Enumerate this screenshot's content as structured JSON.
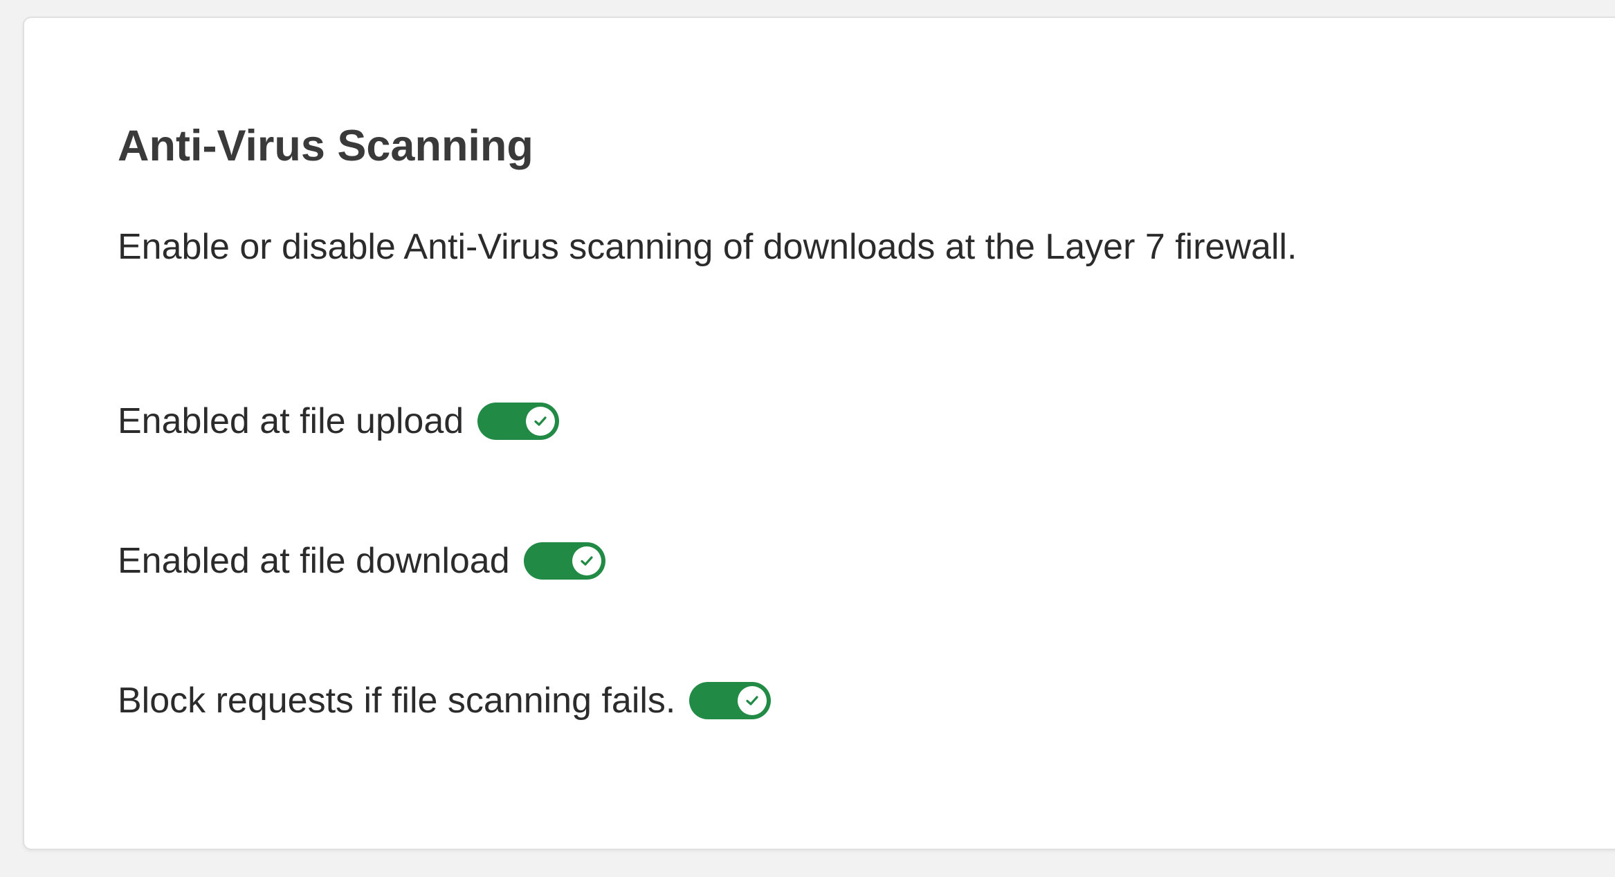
{
  "section": {
    "title": "Anti-Virus Scanning",
    "description": "Enable or disable Anti-Virus scanning of downloads at the Layer 7 firewall."
  },
  "settings": [
    {
      "label": "Enabled at file upload",
      "enabled": true,
      "icon": "check-icon"
    },
    {
      "label": "Enabled at file download",
      "enabled": true,
      "icon": "check-icon"
    },
    {
      "label": "Block requests if file scanning fails.",
      "enabled": true,
      "icon": "check-icon"
    }
  ],
  "colors": {
    "toggle_on": "#218a45",
    "check": "#218a45",
    "text": "#2b2b2b",
    "heading": "#3a3a3a",
    "page_background": "#f2f2f2",
    "card_background": "#ffffff"
  }
}
